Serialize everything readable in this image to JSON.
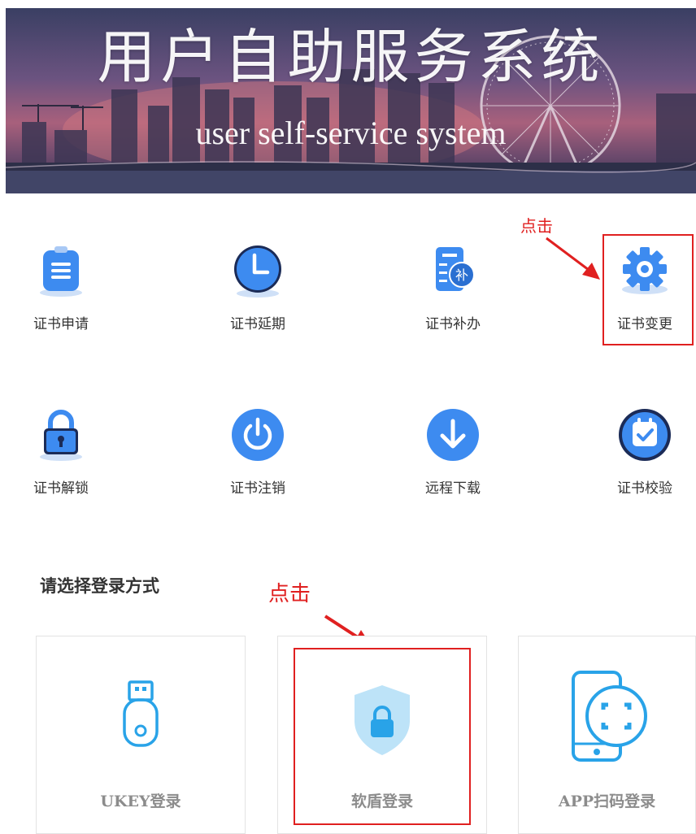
{
  "banner": {
    "title": "用户自助服务系统",
    "subtitle": "user self-service system"
  },
  "services": [
    {
      "label": "证书申请",
      "icon": "clipboard-icon"
    },
    {
      "label": "证书延期",
      "icon": "clock-icon"
    },
    {
      "label": "证书补办",
      "icon": "document-supplement-icon"
    },
    {
      "label": "证书变更",
      "icon": "gear-icon"
    },
    {
      "label": "证书解锁",
      "icon": "padlock-icon"
    },
    {
      "label": "证书注销",
      "icon": "power-icon"
    },
    {
      "label": "远程下载",
      "icon": "download-icon"
    },
    {
      "label": "证书校验",
      "icon": "calendar-check-icon"
    }
  ],
  "supplement_badge": "补",
  "annotations": {
    "click_top": "点击",
    "click_login": "点击"
  },
  "login": {
    "heading": "请选择登录方式",
    "options": [
      {
        "label": "UKEY登录",
        "icon": "usb-key-icon"
      },
      {
        "label": "软盾登录",
        "icon": "shield-lock-icon"
      },
      {
        "label": "APP扫码登录",
        "icon": "phone-scan-icon"
      }
    ]
  },
  "colors": {
    "accent_blue": "#3d8bf0",
    "login_icon_blue": "#29a3e8",
    "annotation_red": "#e02020"
  }
}
